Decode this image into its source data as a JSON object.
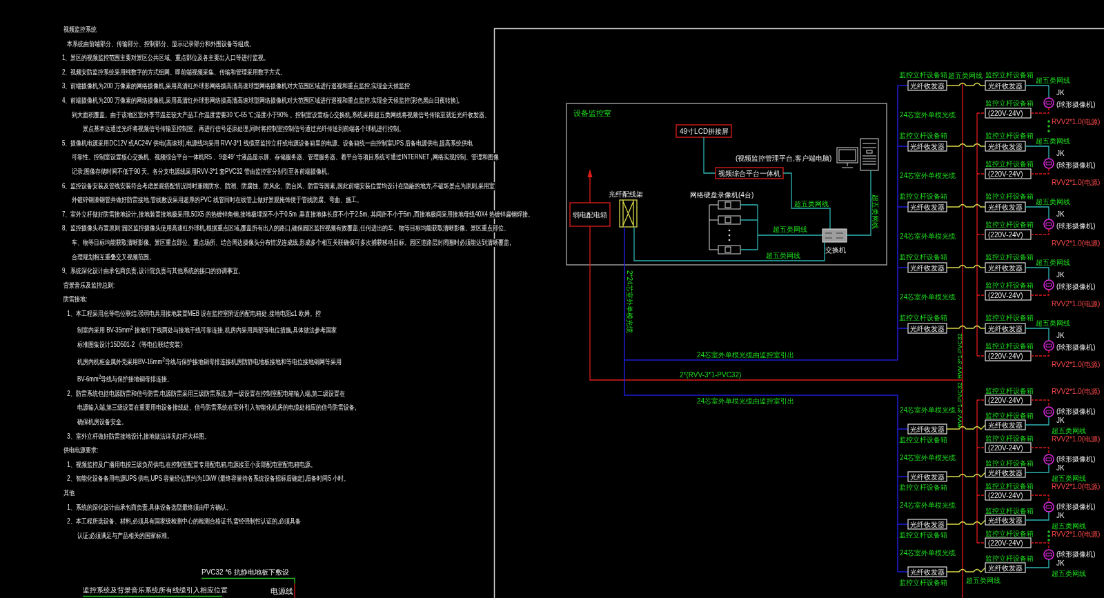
{
  "notes": [
    {
      "kind": "heading",
      "text": "视频监控系统"
    },
    {
      "kind": "paragraph",
      "lines": [
        {
          "kind": "sublead",
          "text": "本系统由前端部分、传输部分、控制部分、显示记录部分和外围设备等组成。"
        }
      ]
    },
    {
      "kind": "paragraph",
      "lines": [
        {
          "kind": "lead",
          "text": "1、景区的视频监控范围主要对景区公共区域、重点部位及各主要出入口等进行监视。"
        }
      ]
    },
    {
      "kind": "paragraph",
      "lines": [
        {
          "kind": "lead",
          "text": "2、视频安防监控系统采用纯数字的方式组网。即前端视频采集、传输和管理采用数字方式。"
        }
      ]
    },
    {
      "kind": "paragraph",
      "lines": [
        {
          "kind": "lead",
          "text": "3、前端摄像机为200 万像素的网络摄像机,采用高清红外球形网络摄高清高速球型网络摄像机对大范围区域进行巡视和重点监控,实现全天候监控"
        }
      ]
    },
    {
      "kind": "paragraph",
      "lines": [
        {
          "kind": "lead",
          "text": "4、前端摄像机为200 万像素的网络摄像机,采用高清红外球形网络摄高清高速球型网络摄像机对大范围区域进行巡视和重点监控,实现全天候监控(彩色黑白日夜转换),"
        },
        {
          "kind": "wrap",
          "text": "到大面积覆盖。由于该地区室外季节温差较大产品工作温度需要30 ℃-65 ℃;湿度小于90% 。控制室设置核心交换机,系统采用超五类网线将视频信号传输至就近光纤收发器、"
        },
        {
          "kind": "deep",
          "text": "景点基本达通过光纤将视频信号传输至控制室、再进行信号还原处理,同时将控制室控制信号通过光纤传送到前端各个球机进行控制。"
        }
      ]
    },
    {
      "kind": "paragraph",
      "lines": [
        {
          "kind": "lead",
          "text": "5、摄像机电源采用DC12V 或AC24V 供电(高速球),电源线均采用 RVV-3*1 线缆至监控立杆或电源设备箱里的电源。设备箱统一由控制室UPS 后备电源供电,提高系统供电"
        },
        {
          "kind": "wrap",
          "text": "可靠性。控制室设置核心交换机、视频综合平台一体机RS 、9套49' 寸液晶显示屏、存储服务器、管理服务器、着平台等项目系统可通过INTERNET ,网络实现控制、管理和图像"
        },
        {
          "kind": "wrap",
          "text": "记录;图像存储时间不低于90 天。各分支电源线采用RVV-3*1 套PVC32 管由监控室分别引至各前端摄像机。"
        }
      ]
    },
    {
      "kind": "paragraph",
      "lines": [
        {
          "kind": "lead",
          "text": "6、监控设备安装及管线安装符合考虑景观搭配情况同时兼顾防水、防潮、防腐蚀、防风化、防台风、防雷等因素,因此前端安装位置均设计在隐蔽的地方,不破坏景点为原则,采用室"
        },
        {
          "kind": "wrap",
          "text": "外镀锌钢漆钢管并做好防雷接地,管线敷设采用超厚的PVC 线管同时在线管上做好景观掩饰便于管线防腐、弯曲、施工。"
        }
      ]
    },
    {
      "kind": "paragraph",
      "lines": [
        {
          "kind": "lead",
          "text": "7、室外立杆做好防雷接地设计,接地装置接地极采用L50X5 的热镀锌角钢,接地极埋深不小于0.5m ,垂直接地体长度不小于2.5m, 其间距不小于5m ,而接地极间采用接地母线40X4 热镀锌扁钢焊接。"
        }
      ]
    },
    {
      "kind": "paragraph",
      "lines": [
        {
          "kind": "lead",
          "text": "8、监控摄像头布置原则:园区监控摄像头使用高速红外球机,根据重点区域,覆盖所有出入的路口,确保园区监控视频有效覆盖,任何进出的车、物等目标均能获取清晰影像。景区重点部位、"
        },
        {
          "kind": "wrap",
          "text": "车、物等目标均能获取清晰影像。景区重点部位、重点场所、结合周边摄像头分布情况连成线,形成多个相互关联确保可多次捕获移动目标。园区道路层封闭圈时必须能达到清晰覆盖,"
        },
        {
          "kind": "wrap",
          "text": "合理规划相互重叠交叉视频范围。"
        }
      ]
    },
    {
      "kind": "paragraph",
      "lines": [
        {
          "kind": "lead",
          "text": "9、系统深化设计由承包商负责,设计院负责与其他系统的接口的协调事宜。"
        }
      ]
    },
    {
      "kind": "heading",
      "text": "背景音乐及监控总则:"
    },
    {
      "kind": "heading",
      "text": "防雷接地:"
    },
    {
      "kind": "paragraph",
      "lines": [
        {
          "kind": "sublead",
          "text": "1、本工程采用总等电位联结,强弱电共用接地装置MEB 设在监控室附近的配电箱处,接地电阻≤1 欧姆。控"
        },
        {
          "kind": "subwrap",
          "text": "制室内采用 BV-35mm$^{2}$ 接地引下线两处与接地干线可靠连接,机房内采用局部等电位措施,具体做法参考国家"
        },
        {
          "kind": "subwrap",
          "text": "标准图集设计15D501-2 《等电位联结安装》"
        },
        {
          "kind": "subwrap",
          "text": "机房内机柜金属外壳采用BV-16mm$^{2}$导线与保护接地铜母排连接机房防静电地板接地和等电位接地铜网等采用"
        },
        {
          "kind": "subwrap",
          "text": "BV-6mm$^{2}$导线与保护接地铜母排连接。"
        }
      ]
    },
    {
      "kind": "paragraph",
      "lines": [
        {
          "kind": "sublead",
          "text": "2、防雷系统包括电源防雷和信号防雷,电源防雷采用三级防雷系统,第一级设置在控制室配电箱输入端,第二级设置在"
        },
        {
          "kind": "subwrap",
          "text": "电源输入端,第三级设置在重要用电设备接线处。信号防雷系统在室外引入智能化机房的电缆处相应的信号防雷设备,"
        },
        {
          "kind": "subwrap",
          "text": "确保机房设备安全。"
        }
      ]
    },
    {
      "kind": "paragraph",
      "lines": [
        {
          "kind": "sublead",
          "text": "3、室外立杆做好防雷接地设计,接地做法详见灯杆大样图。"
        }
      ]
    },
    {
      "kind": "heading",
      "text": "供电电源要求:"
    },
    {
      "kind": "paragraph",
      "lines": [
        {
          "kind": "sublead",
          "text": "1、视频监控及广播用电按三级负荷供电,在控制室配置专用配电箱,电源接至小卖部配电室配电箱电源。"
        }
      ]
    },
    {
      "kind": "paragraph",
      "lines": [
        {
          "kind": "sublead",
          "text": "2、智能化设备备用电源UPS 供电,UPS 容量经估算约为10kW (最终容量待各系统设备招标后确定),后备时间5 小时。"
        }
      ]
    },
    {
      "kind": "heading",
      "text": "其他"
    },
    {
      "kind": "paragraph",
      "lines": [
        {
          "kind": "sublead",
          "text": "1、系统的深化设计由承包商负责,具体设备选型最终须由甲方确认。"
        }
      ]
    },
    {
      "kind": "paragraph",
      "lines": [
        {
          "kind": "sublead",
          "text": "2、本工程所选设备、材料,必须具有国家级检测中心的检测合格证书,需经强制性认证的,必须具备"
        },
        {
          "kind": "subwrap",
          "text": "认证;必须满足与产品相关的国家标准。"
        }
      ]
    }
  ],
  "diagram": {
    "room": {
      "title": "设备监控室",
      "lcd_screen": "49寸LCD拼接屏",
      "platform": "视频综合平台一体机",
      "distribution_box": "弱电配电箱",
      "patch_panel": "光纤配线架",
      "recorders": "网络硬盘录像机(4台)",
      "switch": "交换机",
      "workstation": "(视频监控管理平台,客户端电脑)",
      "cable_labels": [
        "超五类网线",
        "超五类网线",
        "超五类网线",
        "超五类网线"
      ]
    },
    "riser_label": "2*24芯室外单模光缆",
    "trunk_labels": {
      "fiber_upper": "24芯室外单模光缆由监控室引出",
      "power": "2*(RVV-3*1-PVC32)",
      "fiber_lower": "24芯室外单模光缆由监控室引出",
      "power_vertical": [
        "RVV-3*1-PVC32",
        "RVV-3*1-PVC32"
      ]
    },
    "upper_units": [
      {
        "cabinet": "监控立杆设备箱",
        "transceiver": "光纤收发器",
        "link_label": "超五类网线",
        "receiver_cabinet": "监控立杆设备箱",
        "receiver": "光纤收发器",
        "power_cabinet": "监控立杆设备箱",
        "transformer": "(220V-24V)",
        "data_cable": "超五类网线",
        "power_cable": "RVV2*1.0(电源)",
        "camera_code": "JK",
        "camera_type": "(球形摄像机)",
        "fiber": "24芯室外单模光缆",
        "more_below": true
      },
      {
        "cabinet": "监控立杆设备箱",
        "transceiver": "光纤收发器",
        "receiver_cabinet": "监控立杆设备箱",
        "receiver": "光纤收发器",
        "power_cabinet": "监控立杆设备箱",
        "transformer": "(220V-24V)",
        "data_cable": "超五类网线",
        "power_cable": "RVV2*1.0(电源)",
        "camera_code": "JK",
        "camera_type": "(球形摄像机)",
        "fiber": "24芯室外单模光缆",
        "more_below": false
      },
      {
        "cabinet": "监控立杆设备箱",
        "transceiver": "光纤收发器",
        "receiver_cabinet": "监控立杆设备箱",
        "receiver": "光纤收发器",
        "power_cabinet": "监控立杆设备箱",
        "transformer": "(220V-24V)",
        "data_cable": "超五类网线",
        "power_cable": "RVV2*1.0(电源)",
        "camera_code": "JK",
        "camera_type": "(球形摄像机)",
        "fiber": "24芯室外单模光缆",
        "more_below": false
      },
      {
        "cabinet": "监控立杆设备箱",
        "transceiver": "光纤收发器",
        "receiver_cabinet": "监控立杆设备箱",
        "receiver": "光纤收发器",
        "power_cabinet": "监控立杆设备箱",
        "transformer": "(220V-24V)",
        "data_cable": "超五类网线",
        "power_cable": "RVV2*1.0(电源)",
        "camera_code": "JK",
        "camera_type": "(球形摄像机)",
        "fiber": "24芯室外单模光缆",
        "more_below": false
      },
      {
        "cabinet": "监控立杆设备箱",
        "transceiver": "光纤收发器",
        "receiver_cabinet": "监控立杆设备箱",
        "receiver": "光纤收发器",
        "power_cabinet": "监控立杆设备箱",
        "transformer": "(220V-24V)",
        "data_cable": "超五类网线",
        "power_cable": "RVV2*1.0(电源)",
        "camera_code": "JK",
        "camera_type": "(球形摄像机)",
        "more_below": false
      }
    ],
    "lower_units": [
      {
        "cabinet": "监控立杆设备箱",
        "transceiver": "光纤收发器",
        "receiver_cabinet": "监控立杆设备箱",
        "receiver": "光纤收发器",
        "power_cabinet": "监控立杆设备箱",
        "transformer": "(220V-24V)",
        "data_cable": "超五类网线",
        "power_cable": "RVV2*1.0(电源)",
        "camera_code": "JK",
        "camera_type": "(球形摄像机)",
        "fiber": "24芯室外单模光缆",
        "more_below": false
      },
      {
        "cabinet": "监控立杆设备箱",
        "transceiver": "光纤收发器",
        "receiver_cabinet": "监控立杆设备箱",
        "receiver": "光纤收发器",
        "power_cabinet": "监控立杆设备箱",
        "transformer": "(220V-24V)",
        "data_cable": "超五类网线",
        "power_cable": "RVV2*1.0(电源)",
        "camera_code": "JK",
        "camera_type": "(球形摄像机)",
        "fiber": "24芯室外单模光缆",
        "more_below": false
      },
      {
        "cabinet": "监控立杆设备箱",
        "transceiver": "光纤收发器",
        "receiver_cabinet": "监控立杆设备箱",
        "receiver": "光纤收发器",
        "power_cabinet": "监控立杆设备箱",
        "transformer": "(220V-24V)",
        "data_cable": "超五类网线",
        "power_cable": "RVV2*1.0(电源)",
        "camera_code": "JK",
        "camera_type": "(球形摄像机)",
        "fiber": "24芯室外单模光缆",
        "more_below": true
      },
      {
        "cabinet": "监控立杆设备箱",
        "transceiver": "光纤收发器",
        "link_label": "超五类网线",
        "receiver_cabinet": "监控立杆设备箱",
        "receiver": "光纤收发器",
        "power_cabinet": "监控立杆设备箱",
        "transformer": "(220V-24V)",
        "data_cable": "超五类网线",
        "power_cable": "RVV2*1.0(电源)",
        "camera_code": "JK",
        "camera_type": "(球形摄像机)",
        "fiber": "24芯室外单模光缆",
        "more_below": false
      }
    ]
  },
  "cable_notes": {
    "conduit": "PVC32 *6 抗静电地板下敷设",
    "entry": "监控系统及背景音乐系统所有线缆引入相应位置",
    "power": "电源线"
  }
}
